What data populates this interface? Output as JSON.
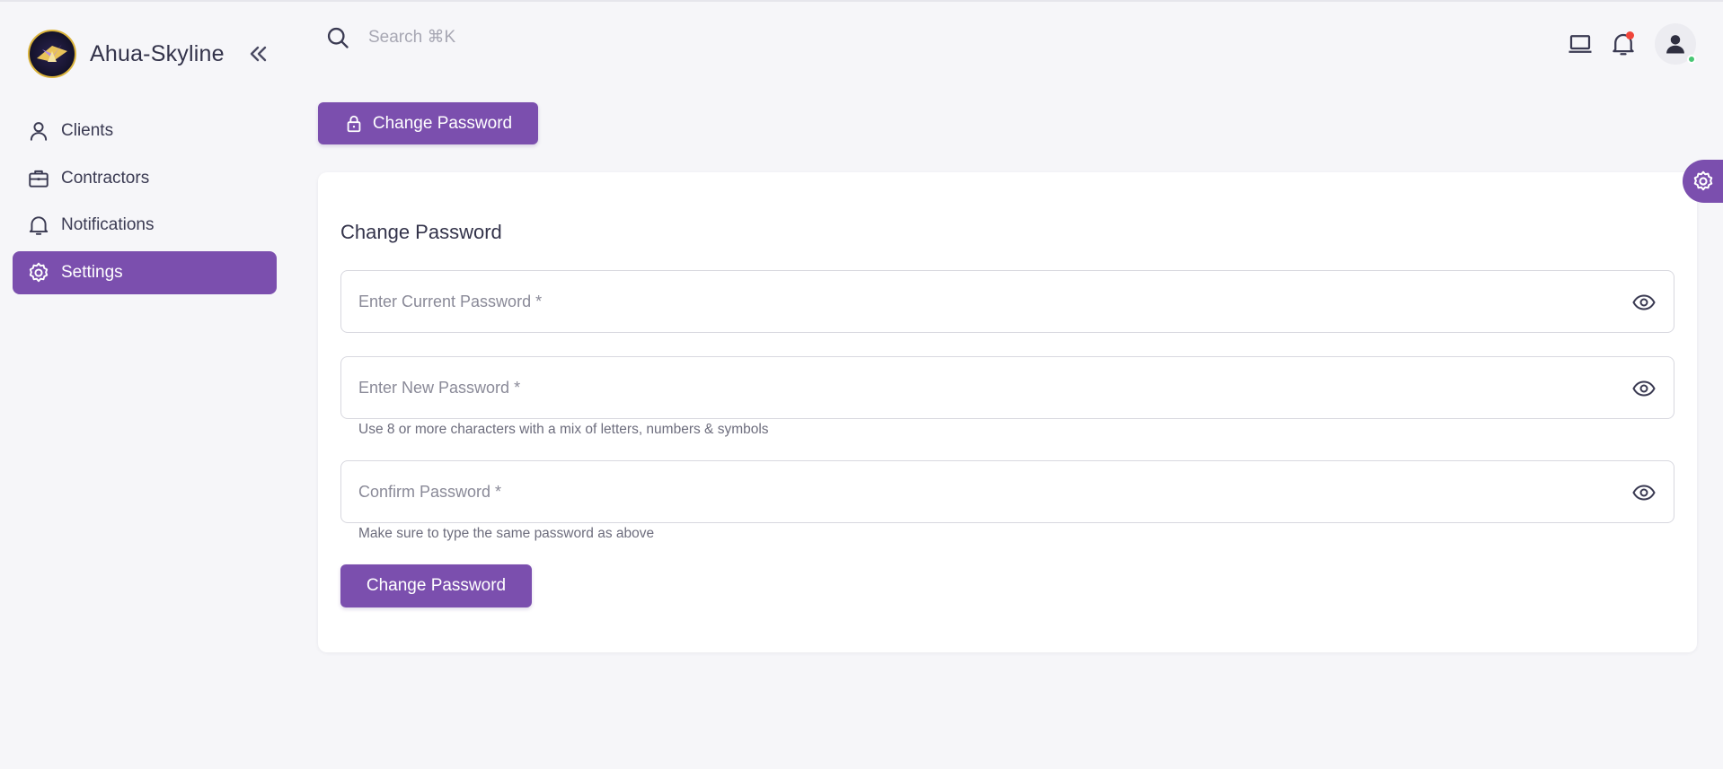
{
  "brand": {
    "name": "Ahua-Skyline"
  },
  "sidebar": {
    "items": [
      {
        "label": "Clients",
        "icon": "user-icon"
      },
      {
        "label": "Contractors",
        "icon": "briefcase-icon"
      },
      {
        "label": "Notifications",
        "icon": "bell-icon"
      },
      {
        "label": "Settings",
        "icon": "gear-icon",
        "active": true
      }
    ]
  },
  "search": {
    "placeholder": "Search ⌘K"
  },
  "header": {
    "change_password_label": "Change Password"
  },
  "form": {
    "title": "Change Password",
    "current_password": {
      "placeholder": "Enter Current Password *"
    },
    "new_password": {
      "placeholder": "Enter New Password *",
      "helper": "Use 8 or more characters with a mix of letters, numbers & symbols"
    },
    "confirm_password": {
      "placeholder": "Confirm Password *",
      "helper": "Make sure to type the same password as above"
    },
    "submit_label": "Change Password"
  },
  "colors": {
    "accent": "#7b4fae",
    "background": "#f6f6f9",
    "notification_dot": "#f0453a",
    "online_dot": "#48c774"
  }
}
